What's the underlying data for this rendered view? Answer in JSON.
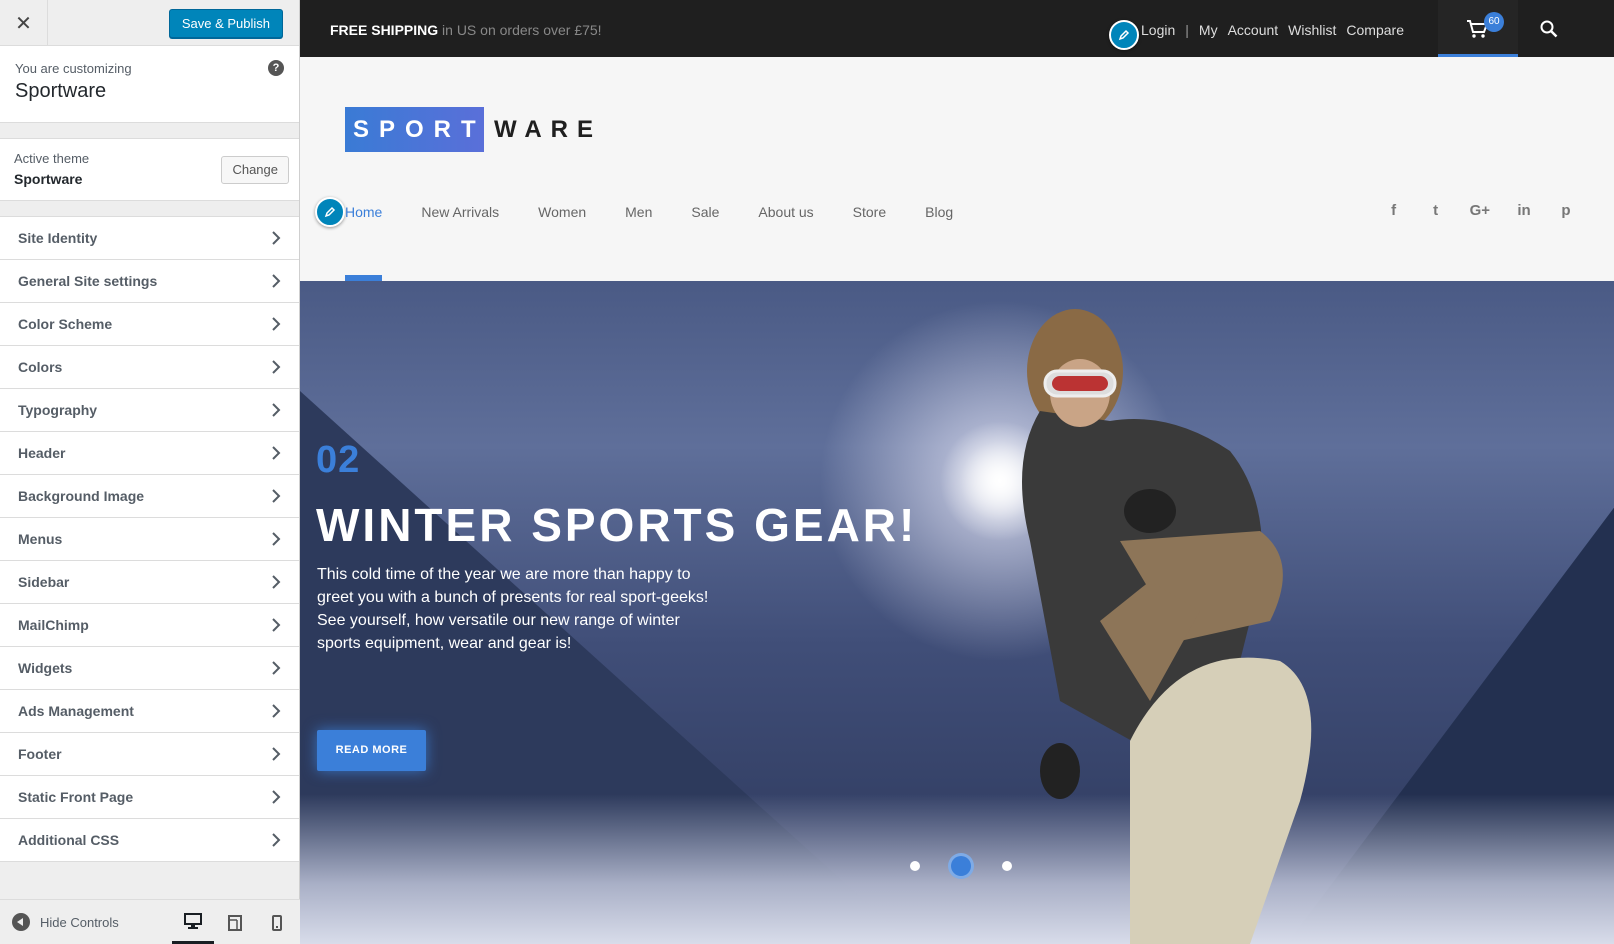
{
  "customizer": {
    "close_icon": "close-icon",
    "publish_label": "Save & Publish",
    "info_sub": "You are customizing",
    "info_title": "Sportware",
    "help_glyph": "?",
    "active_theme_label": "Active theme",
    "active_theme_name": "Sportware",
    "change_label": "Change",
    "sections": [
      {
        "label": "Site Identity"
      },
      {
        "label": "General Site settings"
      },
      {
        "label": "Color Scheme"
      },
      {
        "label": "Colors"
      },
      {
        "label": "Typography"
      },
      {
        "label": "Header"
      },
      {
        "label": "Background Image"
      },
      {
        "label": "Menus"
      },
      {
        "label": "Sidebar"
      },
      {
        "label": "MailChimp"
      },
      {
        "label": "Widgets"
      },
      {
        "label": "Ads Management"
      },
      {
        "label": "Footer"
      },
      {
        "label": "Static Front Page"
      },
      {
        "label": "Additional CSS"
      }
    ],
    "hide_controls_label": "Hide Controls",
    "devices": [
      "desktop",
      "tablet",
      "mobile"
    ],
    "active_device": "desktop"
  },
  "site": {
    "shipping_bold": "FREE SHIPPING",
    "shipping_rest": " in US on orders over £75!",
    "account_links": {
      "login": "Login",
      "sep": "|",
      "my": "My",
      "account": "Account",
      "wishlist": "Wishlist",
      "compare": "Compare"
    },
    "cart_count": "60",
    "logo_part1": "SPORT",
    "logo_part2": "WARE",
    "nav": [
      {
        "label": "Home",
        "active": true
      },
      {
        "label": "New Arrivals"
      },
      {
        "label": "Women"
      },
      {
        "label": "Men"
      },
      {
        "label": "Sale"
      },
      {
        "label": "About us"
      },
      {
        "label": "Store"
      },
      {
        "label": "Blog"
      }
    ],
    "social": {
      "facebook": "f",
      "twitter": "t",
      "google": "G+",
      "linkedin": "in",
      "pinterest": "p"
    },
    "hero": {
      "number": "02",
      "title": "WINTER SPORTS GEAR!",
      "desc_1": "This cold time of the year we are more than happy to greet you with a bunch of presents for real sport-geeks!",
      "desc_2": "See yourself, how versatile our new range of winter sports equipment, wear and gear is!",
      "button": "READ MORE",
      "slides": 3,
      "active_slide": 2
    }
  },
  "colors": {
    "accent": "#3b7fd9",
    "wp_primary": "#0085ba",
    "topbar": "#1f1f1f"
  }
}
